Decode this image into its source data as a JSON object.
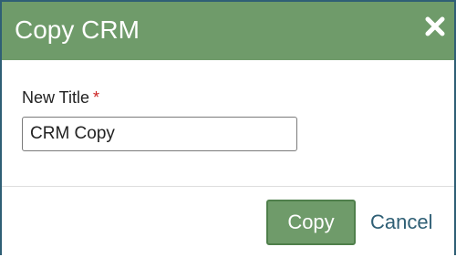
{
  "dialog": {
    "title": "Copy CRM",
    "close_icon": "close-icon"
  },
  "form": {
    "title_label": "New Title",
    "required_marker": "*",
    "title_value": "CRM Copy"
  },
  "actions": {
    "copy_label": "Copy",
    "cancel_label": "Cancel"
  },
  "colors": {
    "header_bg": "#6f9b6a",
    "primary_button_bg": "#6f9b6a",
    "link_color": "#2f5f75",
    "required_color": "#cc2222"
  }
}
